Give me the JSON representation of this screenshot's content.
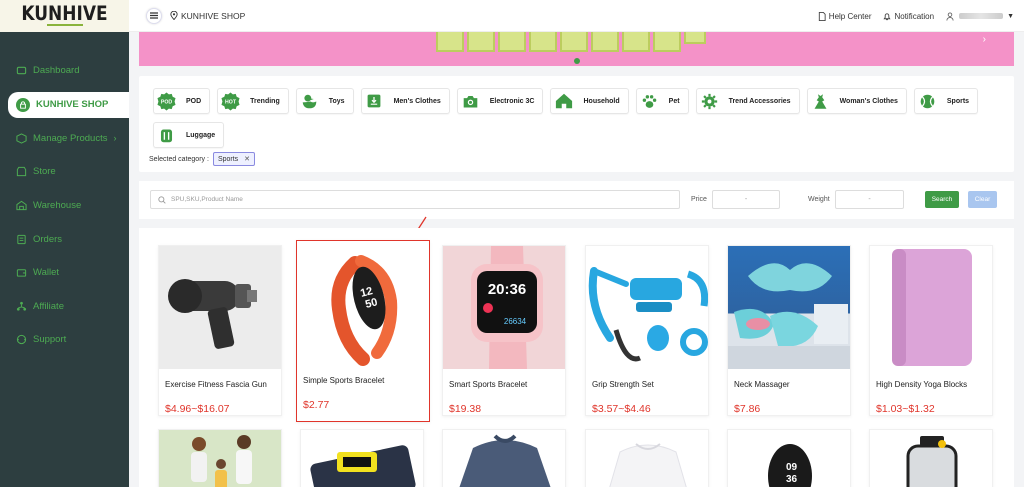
{
  "sidebar": {
    "logo": "KUNHIVE",
    "items": [
      {
        "label": "Dashboard",
        "icon": "home-icon"
      },
      {
        "label": "KUNHIVE SHOP",
        "icon": "shop-icon",
        "active": true
      },
      {
        "label": "Manage Products",
        "icon": "box-icon",
        "has_chevron": true
      },
      {
        "label": "Store",
        "icon": "store-icon"
      },
      {
        "label": "Warehouse",
        "icon": "warehouse-icon"
      },
      {
        "label": "Orders",
        "icon": "orders-icon"
      },
      {
        "label": "Wallet",
        "icon": "wallet-icon"
      },
      {
        "label": "Affiliate",
        "icon": "affiliate-icon"
      },
      {
        "label": "Support",
        "icon": "support-icon"
      }
    ]
  },
  "header": {
    "shop_title": "KUNHIVE SHOP",
    "help": "Help Center",
    "notification": "Notification"
  },
  "categories": [
    {
      "label": "POD",
      "icon": "pod-badge-icon"
    },
    {
      "label": "Trending",
      "icon": "hot-badge-icon"
    },
    {
      "label": "Toys",
      "icon": "duck-icon"
    },
    {
      "label": "Men's Clothes",
      "icon": "shirt-icon"
    },
    {
      "label": "Electronic 3C",
      "icon": "camera-icon"
    },
    {
      "label": "Household",
      "icon": "house-icon"
    },
    {
      "label": "Pet",
      "icon": "paw-icon"
    },
    {
      "label": "Trend Accessories",
      "icon": "gear-icon"
    },
    {
      "label": "Woman's Clothes",
      "icon": "dress-icon"
    },
    {
      "label": "Sports",
      "icon": "ball-icon"
    },
    {
      "label": "Luggage",
      "icon": "luggage-icon"
    }
  ],
  "selected": {
    "label": "Selected category :",
    "value": "Sports"
  },
  "search": {
    "placeholder": "SPU,SKU,Product Name",
    "price_label": "Price",
    "price_sep": "-",
    "weight_label": "Weight",
    "weight_sep": "-",
    "search_btn": "Search",
    "clear_btn": "Clear"
  },
  "products": [
    {
      "name": "Exercise Fitness Fascia Gun",
      "price": "$4.96~$16.07"
    },
    {
      "name": "Simple Sports Bracelet",
      "price": "$2.77",
      "highlighted": true
    },
    {
      "name": "Smart Sports Bracelet",
      "price": "$19.38"
    },
    {
      "name": "Grip Strength Set",
      "price": "$3.57~$4.46"
    },
    {
      "name": "Neck Massager",
      "price": "$7.86"
    },
    {
      "name": "High Density Yoga Blocks",
      "price": "$1.03~$1.32"
    }
  ],
  "colors": {
    "brand_green": "#3f9b46",
    "sidebar_bg": "#2d3e40",
    "price_red": "#e0352b",
    "banner_pink": "#f492c8"
  }
}
